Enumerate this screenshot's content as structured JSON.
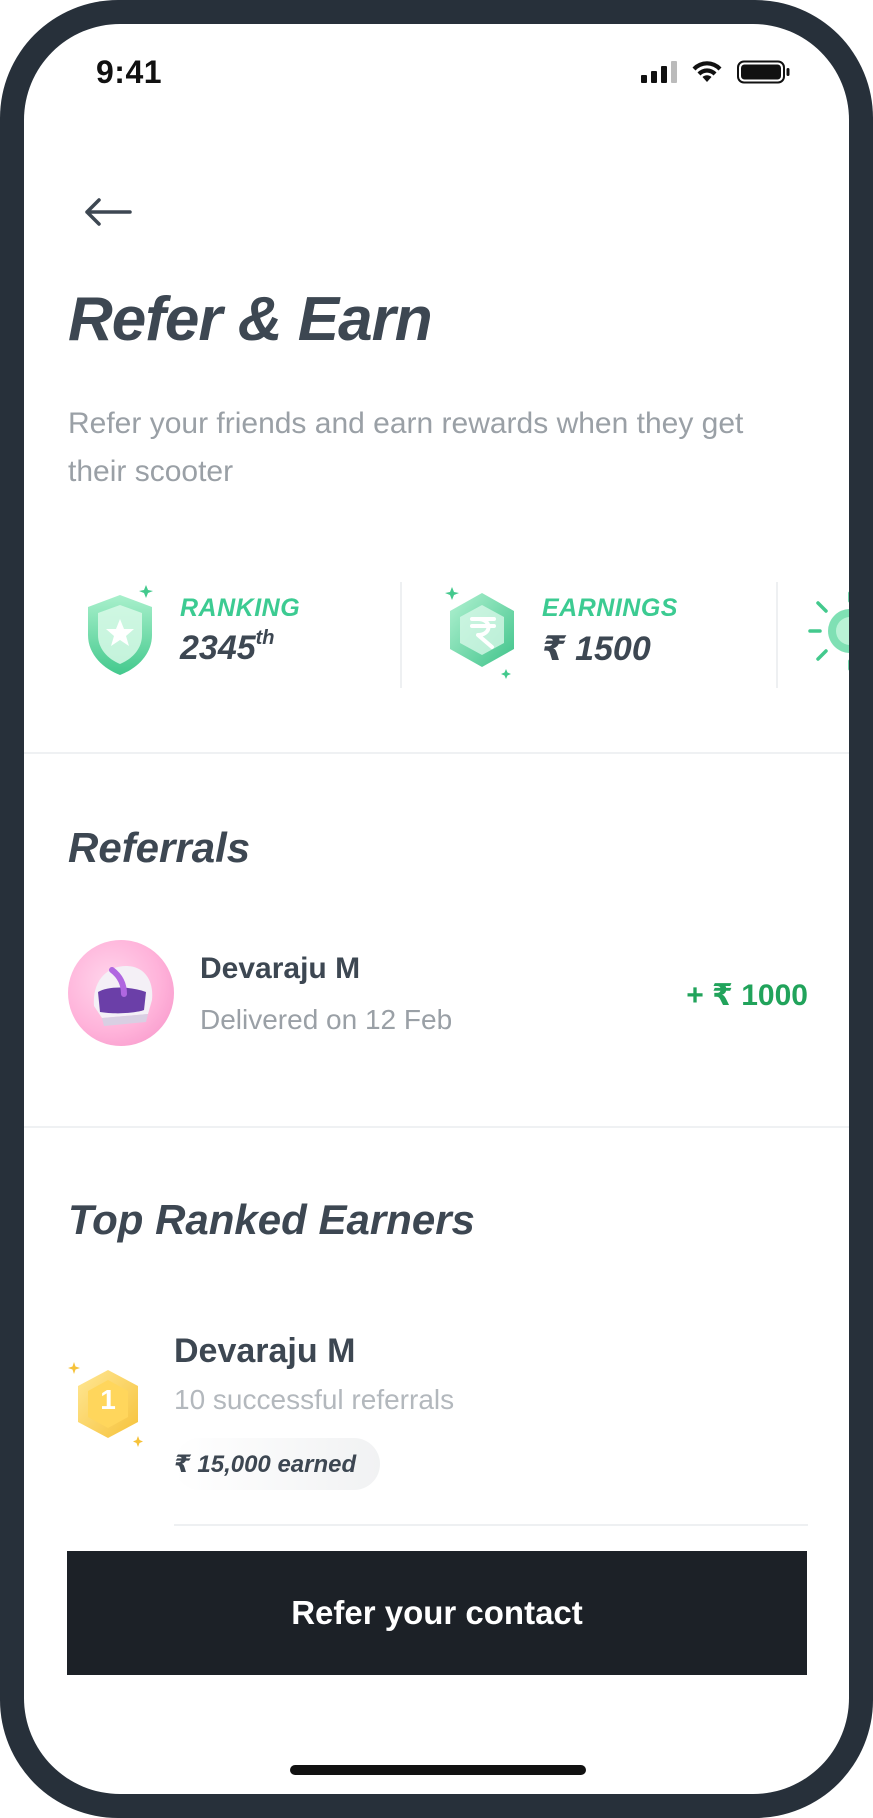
{
  "status_bar": {
    "time": "9:41"
  },
  "header": {
    "title": "Refer & Earn",
    "subtitle": "Refer your friends and earn rewards when they get their scooter"
  },
  "stats": [
    {
      "label": "RANKING",
      "value": "2345",
      "suffix": "th",
      "icon": "shield-star-icon"
    },
    {
      "label": "EARNINGS",
      "value": "₹ 1500",
      "icon": "rupee-hexagon-icon"
    },
    {
      "label": "",
      "value": "",
      "icon": "sun-badge-icon"
    }
  ],
  "referrals": {
    "title": "Referrals",
    "items": [
      {
        "name": "Devaraju M",
        "status": "Delivered on 12 Feb",
        "amount": "+ ₹ 1000",
        "avatar_icon": "helmet-icon"
      }
    ]
  },
  "top_earners": {
    "title": "Top Ranked Earners",
    "items": [
      {
        "rank": "1",
        "name": "Devaraju M",
        "detail": "10 successful referrals",
        "earned": "₹ 15,000 earned"
      }
    ]
  },
  "cta": {
    "label": "Refer your contact"
  },
  "colors": {
    "accent_green": "#3ccb92",
    "amount_green": "#21a35b",
    "text_dark": "#3d4752",
    "text_muted": "#9aa0a6",
    "cta_bg": "#1c2127",
    "device_frame": "#27303a"
  }
}
